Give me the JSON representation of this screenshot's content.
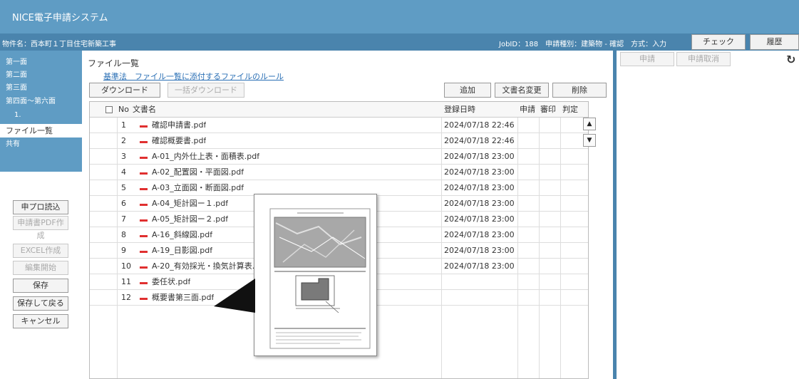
{
  "app": {
    "title": "NICE電子申請システム"
  },
  "info_bar": {
    "project": "物件名：西本町１丁目住宅新築工事",
    "job": "JobID：188　申請種別：建築物 - 確認　方式：入力",
    "check_label": "チェック",
    "history_label": "履歴"
  },
  "sidebar": {
    "items": [
      {
        "label": "第一面"
      },
      {
        "label": "第二面"
      },
      {
        "label": "第三面"
      },
      {
        "label": "第四面～第六面"
      },
      {
        "label": "1."
      },
      {
        "label": "ファイル一覧"
      },
      {
        "label": "共有"
      }
    ]
  },
  "left_buttons": {
    "read_label": "申プロ読込",
    "pdf_label": "申請書PDF作成",
    "excel_label": "EXCEL作成",
    "edit_label": "編集開始",
    "save_label": "保存",
    "save_back_label": "保存して戻る",
    "cancel_label": "キャンセル"
  },
  "file_list": {
    "title": "ファイル一覧",
    "rule_link": "基準法　ファイル一覧に添付するファイルのルール",
    "download_label": "ダウンロード",
    "bulk_download_label": "一括ダウンロード",
    "add_label": "追加",
    "rename_label": "文書名変更",
    "delete_label": "削除",
    "columns": {
      "no": "No",
      "name": "文書名",
      "date": "登録日時",
      "apply": "申請",
      "seal": "審印",
      "judge": "判定"
    },
    "rows": [
      {
        "no": "1",
        "name": "確認申請書.pdf",
        "date": "2024/07/18 22:46"
      },
      {
        "no": "2",
        "name": "確認概要書.pdf",
        "date": "2024/07/18 22:46"
      },
      {
        "no": "3",
        "name": "A-01_内外仕上表・面積表.pdf",
        "date": "2024/07/18 23:00"
      },
      {
        "no": "4",
        "name": "A-02_配置図・平面図.pdf",
        "date": "2024/07/18 23:00"
      },
      {
        "no": "5",
        "name": "A-03_立面図・断面図.pdf",
        "date": "2024/07/18 23:00"
      },
      {
        "no": "6",
        "name": "A-04_矩計図ー１.pdf",
        "date": "2024/07/18 23:00"
      },
      {
        "no": "7",
        "name": "A-05_矩計図ー２.pdf",
        "date": "2024/07/18 23:00"
      },
      {
        "no": "8",
        "name": "A-16_斜線図.pdf",
        "date": "2024/07/18 23:00"
      },
      {
        "no": "9",
        "name": "A-19_日影図.pdf",
        "date": "2024/07/18 23:00"
      },
      {
        "no": "10",
        "name": "A-20_有効採光・換気計算表.pdf",
        "date": "2024/07/18 23:00"
      },
      {
        "no": "11",
        "name": "委任状.pdf",
        "date": ""
      },
      {
        "no": "12",
        "name": "概要書第三面.pdf",
        "date": ""
      }
    ]
  },
  "right_panel": {
    "apply_label": "申請",
    "cancel_apply_label": "申請取消"
  },
  "icons": {
    "pdf": "pdf-file-icon",
    "up": "chevron-up-icon",
    "down": "chevron-down-icon",
    "refresh": "refresh-icon",
    "checkbox": "checkbox-icon"
  }
}
